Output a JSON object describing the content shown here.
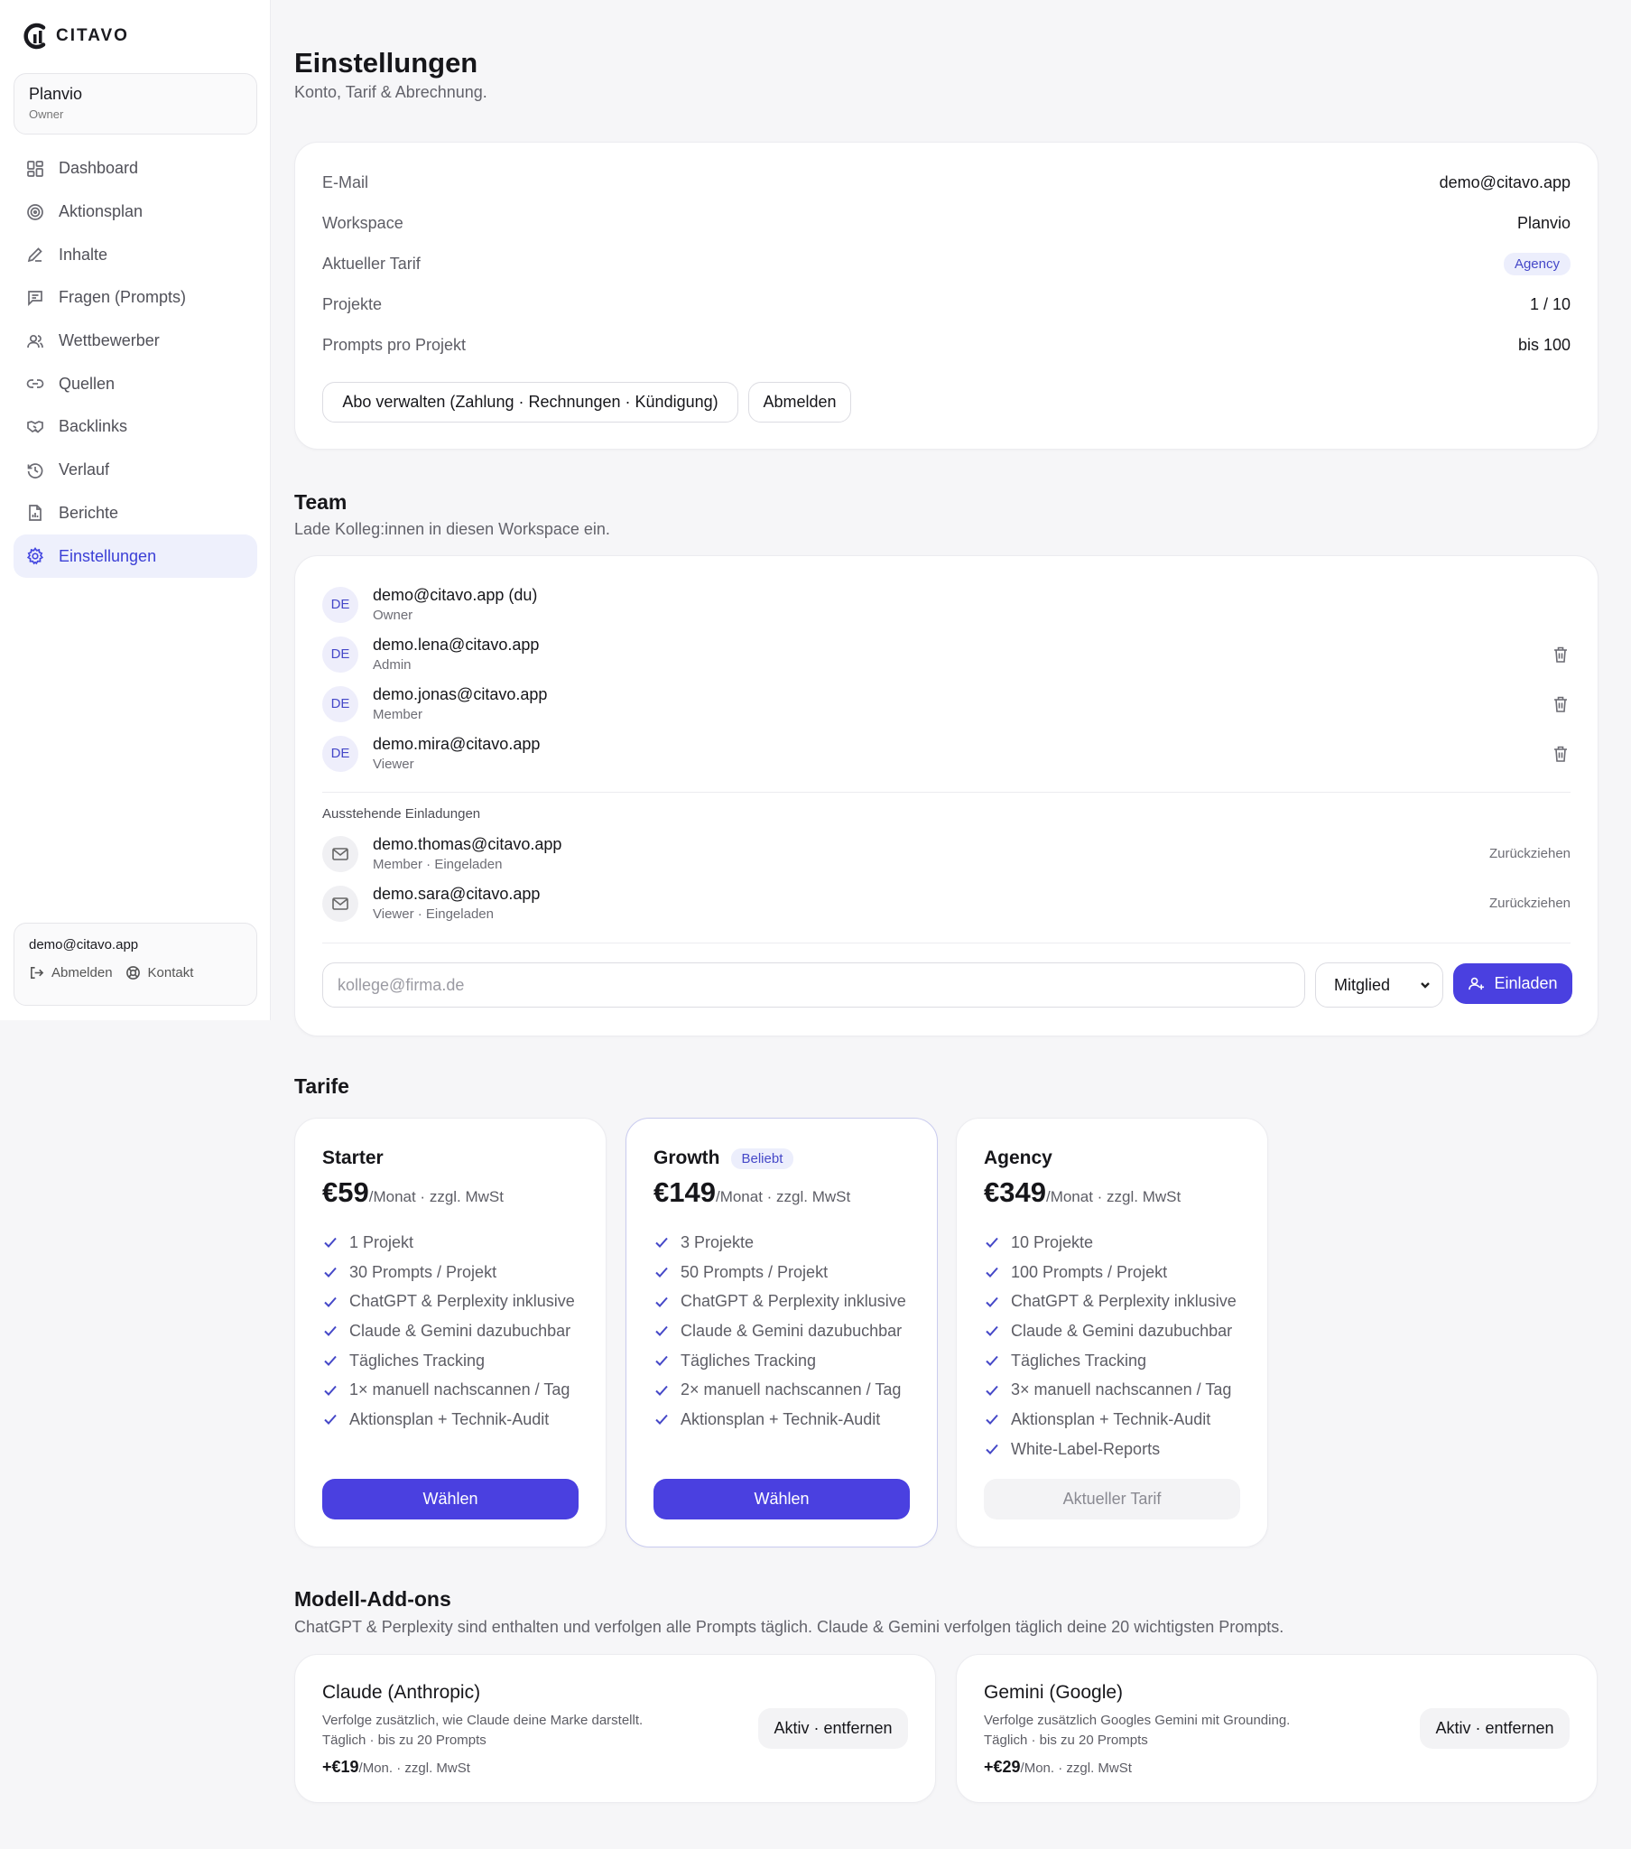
{
  "brand": {
    "name": "CITAVO",
    "accent": "#4a40e0"
  },
  "workspace": {
    "name": "Planvio",
    "role": "Owner"
  },
  "sidebar": {
    "items": [
      {
        "label": "Dashboard",
        "icon": "dashboard-icon"
      },
      {
        "label": "Aktionsplan",
        "icon": "target-icon"
      },
      {
        "label": "Inhalte",
        "icon": "pen-icon"
      },
      {
        "label": "Fragen (Prompts)",
        "icon": "message-icon"
      },
      {
        "label": "Wettbewerber",
        "icon": "users-icon"
      },
      {
        "label": "Quellen",
        "icon": "link-icon"
      },
      {
        "label": "Backlinks",
        "icon": "handshake-icon"
      },
      {
        "label": "Verlauf",
        "icon": "history-icon"
      },
      {
        "label": "Berichte",
        "icon": "report-icon"
      },
      {
        "label": "Einstellungen",
        "icon": "gear-icon",
        "active": true
      }
    ]
  },
  "user": {
    "email": "demo@citavo.app",
    "logout_label": "Abmelden",
    "contact_label": "Kontakt"
  },
  "page": {
    "title": "Einstellungen",
    "subtitle": "Konto, Tarif & Abrechnung."
  },
  "account": {
    "rows": [
      {
        "label": "E-Mail",
        "value": "demo@citavo.app"
      },
      {
        "label": "Workspace",
        "value": "Planvio"
      },
      {
        "label": "Aktueller Tarif",
        "value": "Agency"
      },
      {
        "label": "Projekte",
        "value": "1 / 10"
      },
      {
        "label": "Prompts pro Projekt",
        "value": "bis 100"
      }
    ],
    "manage_label": "Abo verwalten (Zahlung · Rechnungen · Kündigung)",
    "logout_label": "Abmelden"
  },
  "team": {
    "title": "Team",
    "subtitle": "Lade Kolleg:innen in diesen Workspace ein.",
    "members": [
      {
        "initials": "DE",
        "email": "demo@citavo.app (du)",
        "role": "Owner"
      },
      {
        "initials": "DE",
        "email": "demo.lena@citavo.app",
        "role": "Admin"
      },
      {
        "initials": "DE",
        "email": "demo.jonas@citavo.app",
        "role": "Member"
      },
      {
        "initials": "DE",
        "email": "demo.mira@citavo.app",
        "role": "Viewer"
      }
    ],
    "pending_label": "Ausstehende Einladungen",
    "pending": [
      {
        "email": "demo.thomas@citavo.app",
        "role": "Member · Eingeladen",
        "action": "Zurückziehen"
      },
      {
        "email": "demo.sara@citavo.app",
        "role": "Viewer · Eingeladen",
        "action": "Zurückziehen"
      }
    ],
    "invite_placeholder": "kollege@firma.de",
    "invite_role": "Mitglied",
    "invite_button": "Einladen"
  },
  "plans": {
    "title": "Tarife",
    "items": [
      {
        "name": "Starter",
        "badge": "",
        "price": "€59",
        "suffix": "/Monat · zzgl. MwSt",
        "features": [
          "1 Projekt",
          "30 Prompts / Projekt",
          "ChatGPT & Perplexity inklusive",
          "Claude & Gemini dazubuchbar",
          "Tägliches Tracking",
          "1× manuell nachscannen / Tag",
          "Aktionsplan + Technik-Audit"
        ],
        "button": "Wählen"
      },
      {
        "name": "Growth",
        "badge": "Beliebt",
        "price": "€149",
        "suffix": "/Monat · zzgl. MwSt",
        "features": [
          "3 Projekte",
          "50 Prompts / Projekt",
          "ChatGPT & Perplexity inklusive",
          "Claude & Gemini dazubuchbar",
          "Tägliches Tracking",
          "2× manuell nachscannen / Tag",
          "Aktionsplan + Technik-Audit"
        ],
        "button": "Wählen"
      },
      {
        "name": "Agency",
        "badge": "",
        "price": "€349",
        "suffix": "/Monat · zzgl. MwSt",
        "features": [
          "10 Projekte",
          "100 Prompts / Projekt",
          "ChatGPT & Perplexity inklusive",
          "Claude & Gemini dazubuchbar",
          "Tägliches Tracking",
          "3× manuell nachscannen / Tag",
          "Aktionsplan + Technik-Audit",
          "White-Label-Reports"
        ],
        "button": "Aktueller Tarif"
      }
    ]
  },
  "addons": {
    "title": "Modell-Add-ons",
    "subtitle": "ChatGPT & Perplexity sind enthalten und verfolgen alle Prompts täglich. Claude & Gemini verfolgen täglich deine 20 wichtigsten Prompts.",
    "items": [
      {
        "name": "Claude (Anthropic)",
        "desc": "Verfolge zusätzlich, wie Claude deine Marke darstellt.",
        "limit": "Täglich · bis zu 20 Prompts",
        "price": "+€19",
        "suffix": "/Mon. · zzgl. MwSt",
        "button": "Aktiv · entfernen"
      },
      {
        "name": "Gemini (Google)",
        "desc": "Verfolge zusätzlich Googles Gemini mit Grounding.",
        "limit": "Täglich · bis zu 20 Prompts",
        "price": "+€29",
        "suffix": "/Mon. · zzgl. MwSt",
        "button": "Aktiv · entfernen"
      }
    ]
  }
}
